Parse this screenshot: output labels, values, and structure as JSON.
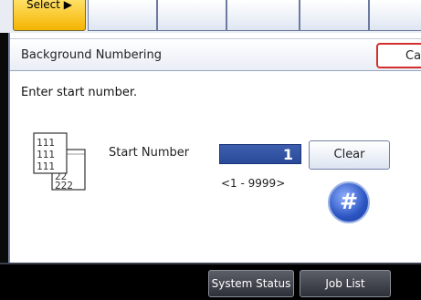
{
  "top_tabs": {
    "selected_label": "Select ▶",
    "segments": [
      "",
      "",
      "",
      "",
      ""
    ]
  },
  "dialog": {
    "title": "Background Numbering",
    "cancel_label": "Can",
    "instruction": "Enter start number.",
    "start_number_label": "Start Number",
    "start_number_value": "1",
    "range_text": "<1 - 9999>",
    "clear_label": "Clear",
    "hash_label": "#"
  },
  "footer": {
    "system_status_label": "System Status",
    "job_list_label": "Job List"
  },
  "icon": {
    "name": "background-numbering-icon",
    "digits_front": "111",
    "digits_back": "22"
  }
}
